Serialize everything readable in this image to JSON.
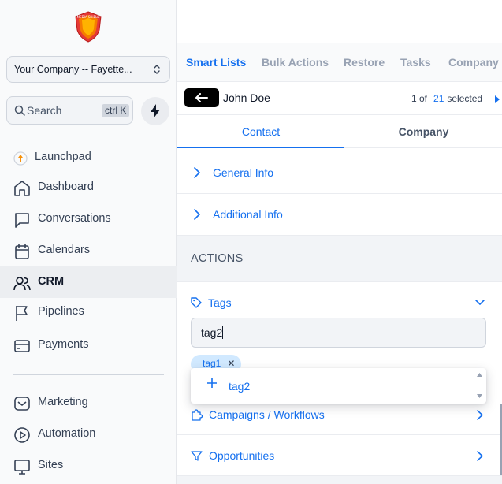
{
  "sidebar": {
    "logo_icon": "shield-logo-icon",
    "logo_text": "MEDIA SHIELD",
    "company_name": "Your Company -- Fayette...",
    "search": {
      "label": "Search",
      "shortcut": "ctrl K"
    },
    "items": [
      {
        "label": "Launchpad",
        "icon": "rocket-icon"
      },
      {
        "label": "Dashboard",
        "icon": "home-icon"
      },
      {
        "label": "Conversations",
        "icon": "chat-icon"
      },
      {
        "label": "Calendars",
        "icon": "calendar-icon"
      },
      {
        "label": "CRM",
        "icon": "users-icon",
        "active": true
      },
      {
        "label": "Pipelines",
        "icon": "flag-icon"
      },
      {
        "label": "Payments",
        "icon": "card-icon"
      },
      {
        "label": "Marketing",
        "icon": "mail-icon"
      },
      {
        "label": "Automation",
        "icon": "play-icon"
      },
      {
        "label": "Sites",
        "icon": "monitor-icon"
      }
    ]
  },
  "topbar": {
    "tabs": [
      {
        "label": "Smart Lists",
        "active": true
      },
      {
        "label": "Bulk Actions"
      },
      {
        "label": "Restore"
      },
      {
        "label": "Tasks"
      },
      {
        "label": "Company"
      }
    ]
  },
  "record": {
    "name": "John Doe",
    "pager_position": "1 of",
    "pager_count": "21",
    "pager_suffix": "selected"
  },
  "subtabs": {
    "contact": "Contact",
    "company": "Company"
  },
  "sections": {
    "general": "General Info",
    "additional": "Additional Info"
  },
  "actions": {
    "heading": "ACTIONS",
    "tags_label": "Tags",
    "tag_input_value": "tag2",
    "existing_tag": "tag1",
    "dropdown_option": "tag2",
    "campaigns_label": "Campaigns / Workflows",
    "opportunities_label": "Opportunities"
  },
  "colors": {
    "accent": "#1570ef",
    "chip_bg": "#d1e9ff",
    "logo_red": "#e53935"
  }
}
